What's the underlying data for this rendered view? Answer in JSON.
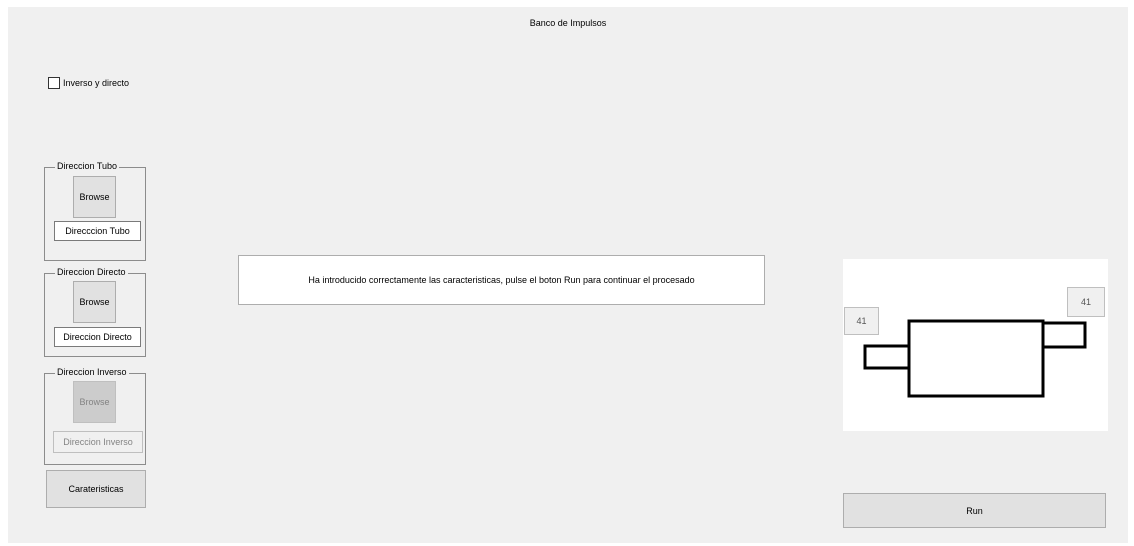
{
  "window": {
    "title": "Banco de Impulsos"
  },
  "options": {
    "inverse_and_direct_label": "Inverso y directo",
    "inverse_and_direct_checked": false
  },
  "panels": {
    "tube": {
      "legend": "Direccion Tubo",
      "browse_label": "Browse",
      "path_value": "Direcccion Tubo"
    },
    "direct": {
      "legend": "Direccion Directo",
      "browse_label": "Browse",
      "path_value": "Direccion Directo"
    },
    "inverse": {
      "legend": "Direccion Inverso",
      "browse_label": "Browse",
      "path_value": "Direccion Inverso",
      "enabled": false
    }
  },
  "buttons": {
    "characteristics_label": "Carateristicas",
    "run_label": "Run"
  },
  "status": {
    "message": "Ha introducido correctamente las caracteristicas, pulse el boton Run para continuar el procesado"
  },
  "diagram": {
    "left_dimension": "41",
    "right_dimension": "41"
  }
}
